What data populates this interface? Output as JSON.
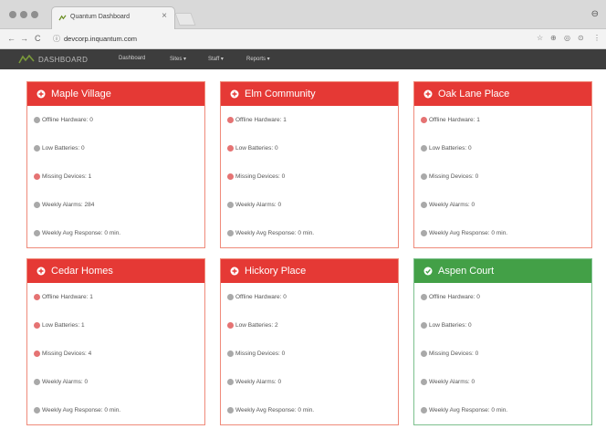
{
  "browser": {
    "tab_title": "Quantum Dashboard",
    "url": "devcorp.inquantum.com",
    "close_glyph": "×",
    "back_glyph": "←",
    "forward_glyph": "→",
    "reload_glyph": "C",
    "lock_glyph": "ⓘ",
    "ext_glyphs": [
      "☆",
      "⊕",
      "◎",
      "⊙",
      "⋮"
    ],
    "profile_glyph": "⊖"
  },
  "appnav": {
    "brand": "DASHBOARD",
    "links": [
      "Dashboard",
      "Sites ▾",
      "Staff ▾",
      "Reports ▾"
    ]
  },
  "colors": {
    "alert_header": "#e53935",
    "ok_header": "#43a047",
    "alert_border": "#ef8a7a",
    "ok_border": "#7cc08d",
    "navbar": "#3d3d3d"
  },
  "cards": [
    {
      "title": "Maple Village",
      "status": "alert",
      "rows": [
        {
          "text": "Offline Hardware: 0",
          "icon": "gray"
        },
        {
          "text": "Low Batteries: 0",
          "icon": "gray"
        },
        {
          "text": "Missing Devices: 1",
          "icon": "red"
        },
        {
          "text": "Weekly Alarms: 284",
          "icon": "gray"
        },
        {
          "text": "Weekly Avg Response: 0 min.",
          "icon": "gray"
        }
      ]
    },
    {
      "title": "Elm Community",
      "status": "alert",
      "rows": [
        {
          "text": "Offline Hardware: 1",
          "icon": "red"
        },
        {
          "text": "Low Batteries: 0",
          "icon": "red"
        },
        {
          "text": "Missing Devices: 0",
          "icon": "red"
        },
        {
          "text": "Weekly Alarms: 0",
          "icon": "gray"
        },
        {
          "text": "Weekly Avg Response: 0 min.",
          "icon": "gray"
        }
      ]
    },
    {
      "title": "Oak Lane Place",
      "status": "alert",
      "rows": [
        {
          "text": "Offline Hardware: 1",
          "icon": "red"
        },
        {
          "text": "Low Batteries: 0",
          "icon": "gray"
        },
        {
          "text": "Missing Devices: 0",
          "icon": "gray"
        },
        {
          "text": "Weekly Alarms: 0",
          "icon": "gray"
        },
        {
          "text": "Weekly Avg Response: 0 min.",
          "icon": "gray"
        }
      ]
    },
    {
      "title": "Cedar Homes",
      "status": "alert",
      "rows": [
        {
          "text": "Offline Hardware: 1",
          "icon": "red"
        },
        {
          "text": "Low Batteries: 1",
          "icon": "red"
        },
        {
          "text": "Missing Devices: 4",
          "icon": "red"
        },
        {
          "text": "Weekly Alarms: 0",
          "icon": "gray"
        },
        {
          "text": "Weekly Avg Response: 0 min.",
          "icon": "gray"
        }
      ]
    },
    {
      "title": "Hickory Place",
      "status": "alert",
      "rows": [
        {
          "text": "Offline Hardware: 0",
          "icon": "gray"
        },
        {
          "text": "Low Batteries: 2",
          "icon": "red"
        },
        {
          "text": "Missing Devices: 0",
          "icon": "gray"
        },
        {
          "text": "Weekly Alarms: 0",
          "icon": "gray"
        },
        {
          "text": "Weekly Avg Response: 0 min.",
          "icon": "gray"
        }
      ]
    },
    {
      "title": "Aspen Court",
      "status": "ok",
      "rows": [
        {
          "text": "Offline Hardware: 0",
          "icon": "gray"
        },
        {
          "text": "Low Batteries: 0",
          "icon": "gray"
        },
        {
          "text": "Missing Devices: 0",
          "icon": "gray"
        },
        {
          "text": "Weekly Alarms: 0",
          "icon": "gray"
        },
        {
          "text": "Weekly Avg Response: 0 min.",
          "icon": "gray"
        }
      ]
    }
  ]
}
